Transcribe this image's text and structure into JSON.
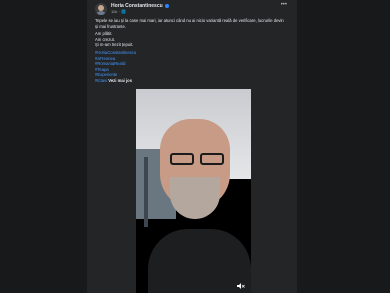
{
  "post": {
    "author": "Horia Constantinescu",
    "meta": "11h · ",
    "text_paragraph1": "Tepele se iau și la case mai mari, iar atunci când nu ai nicio variantă reală de verificare, lucrurile devin și mai frustrante.",
    "text_lines": [
      "Am plătit.",
      "Am crezut.",
      "Și m-am trezit țepuit."
    ],
    "hashtags": [
      "#HoriaConstantinescu",
      "#aTreonea",
      "#RomaniaRealiz",
      "#Teapa",
      "#Experiente"
    ],
    "last_tag": "#Ictavi",
    "last_bold": "Vezi mai jos"
  },
  "video": {
    "muted_icon": "speaker-muted-icon"
  }
}
